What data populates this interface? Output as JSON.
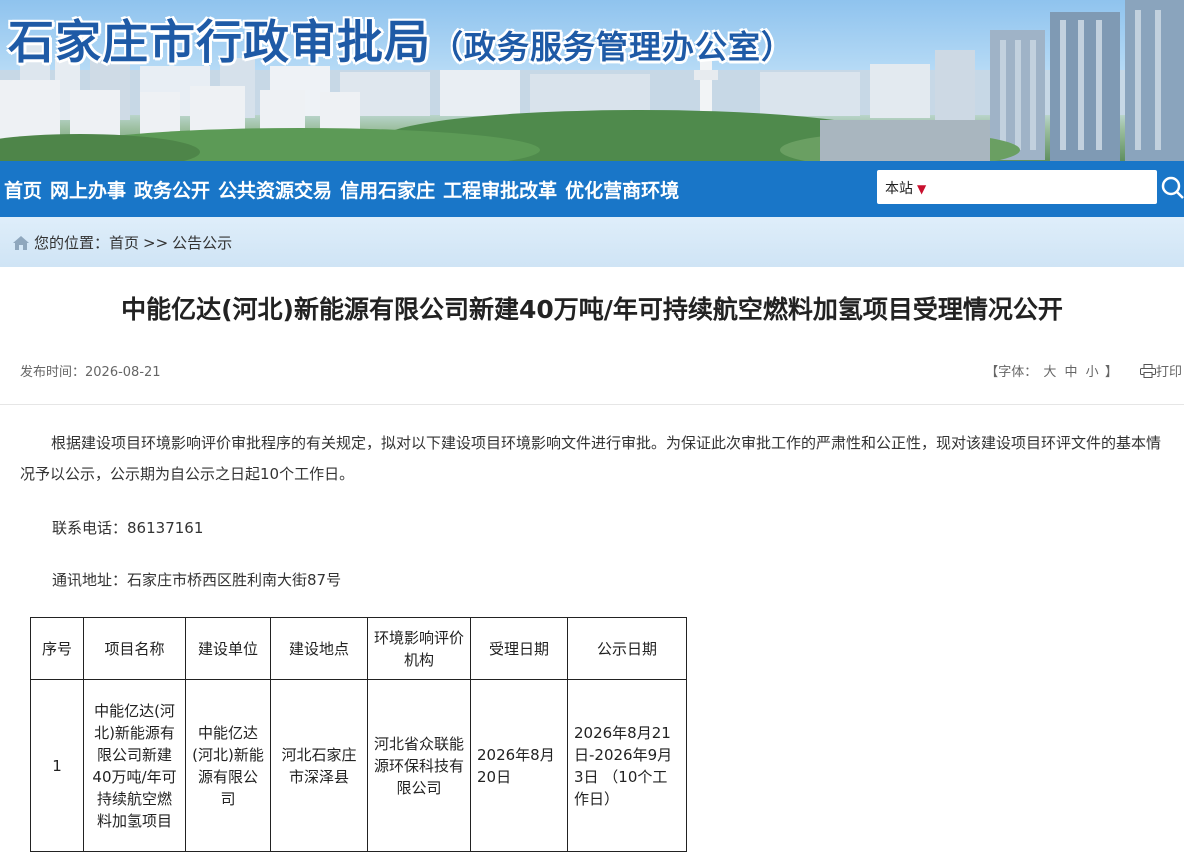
{
  "header": {
    "title": "石家庄市行政审批局",
    "subtitle": "（政务服务管理办公室）"
  },
  "nav": {
    "items": [
      "首页",
      "网上办事",
      "政务公开",
      "公共资源交易",
      "信用石家庄",
      "工程审批改革",
      "优化营商环境"
    ]
  },
  "search": {
    "scope_label": "本站",
    "placeholder": "",
    "icon": "search-icon"
  },
  "breadcrumb": {
    "prefix": "您的位置：",
    "home": "首页",
    "separator": ">>",
    "current": "公告公示",
    "icon": "home-icon"
  },
  "article": {
    "title": "中能亿达(河北)新能源有限公司新建40万吨/年可持续航空燃料加氢项目受理情况公开",
    "publish_label": "发布时间：",
    "publish_date": "2026-08-21",
    "font_label": "【字体：",
    "font_sizes": [
      "大",
      "中",
      "小"
    ],
    "font_close": "】",
    "print_label": "打印",
    "intro": "根据建设项目环境影响评价审批程序的有关规定，拟对以下建设项目环境影响文件进行审批。为保证此次审批工作的严肃性和公正性，现对该建设项目环评文件的基本情况予以公示，公示期为自公示之日起10个工作日。",
    "phone_label": "联系电话：",
    "phone": "86137161",
    "address_label": "通讯地址：",
    "address": "石家庄市桥西区胜利南大街87号"
  },
  "table": {
    "headers": [
      "序号",
      "项目名称",
      "建设单位",
      "建设地点",
      "环境影响评价机构",
      "受理日期",
      "公示日期"
    ],
    "rows": [
      [
        "1",
        "中能亿达(河北)新能源有限公司新建40万吨/年可持续航空燃料加氢项目",
        "中能亿达(河北)新能源有限公司",
        "河北石家庄市深泽县",
        "河北省众联能源环保科技有限公司",
        "2026年8月20日",
        "2026年8月21日-2026年9月3日 （10个工作日）"
      ]
    ]
  },
  "colors": {
    "nav_bg": "#1976c8",
    "title_blue": "#1e5aa6",
    "caret_red": "#c8102e"
  }
}
